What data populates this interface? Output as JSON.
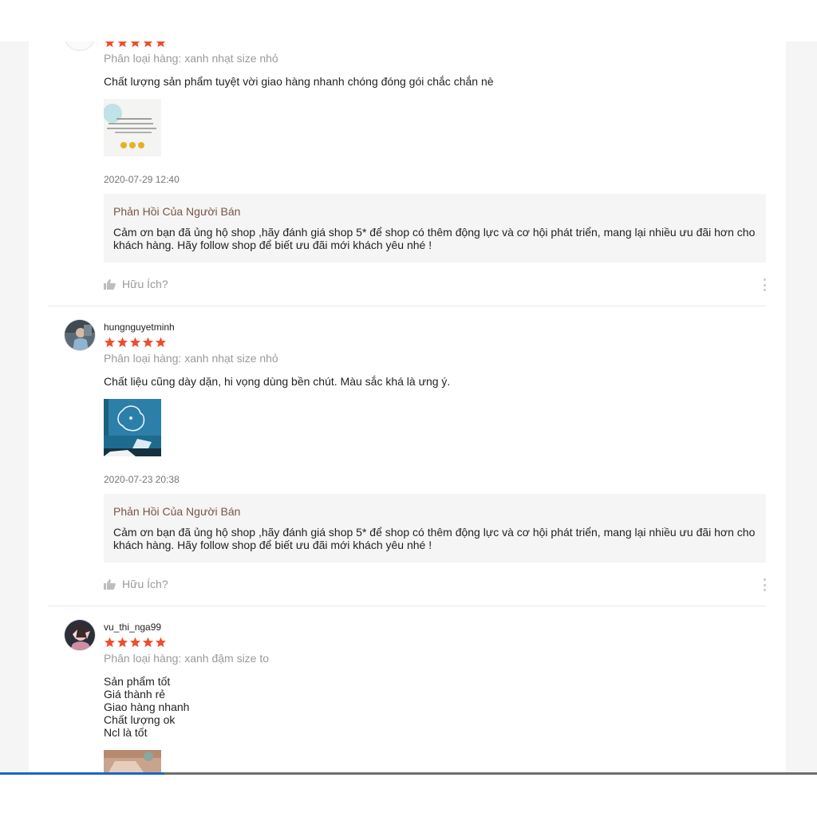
{
  "reviews": [
    {
      "username": "",
      "rating": 5,
      "variant": "Phân loại hàng: xanh nhạt size nhỏ",
      "comment": "Chất lượng sản phẩm tuyệt vời giao hàng nhanh chóng đóng gói chắc chắn nè",
      "time": "2020-07-29 12:40",
      "reply_title": "Phản Hồi Của Người Bán",
      "reply_text": "Cảm ơn bạn đã ủng hộ shop ,hãy đánh giá shop 5* để shop có thêm động lực và cơ hội phát triển, mang lại nhiều ưu đãi hơn cho khách hàng. Hãy follow shop để biết ưu đãi mới khách yêu nhé !",
      "helpful": "Hữu Ích?"
    },
    {
      "username": "hungnguyetminh",
      "rating": 5,
      "variant": "Phân loại hàng: xanh nhạt size nhỏ",
      "comment": "Chất liệu cũng dày dặn, hi vọng dùng bền chút. Màu sắc khá là ưng ý.",
      "time": "2020-07-23 20:38",
      "reply_title": "Phản Hồi Của Người Bán",
      "reply_text": "Cảm ơn bạn đã ủng hộ shop ,hãy đánh giá shop 5* để shop có thêm động lực và cơ hội phát triển, mang lại nhiều ưu đãi hơn cho khách hàng. Hãy follow shop để biết ưu đãi mới khách yêu nhé !",
      "helpful": "Hữu Ích?"
    },
    {
      "username": "vu_thi_nga99",
      "rating": 5,
      "variant": "Phân loại hàng: xanh đậm size to",
      "comment": "Sản phẩm tốt\nGiá thành rẻ\nGiao hàng nhanh\nChất lượng ok\nNcl là tốt"
    }
  ],
  "colors": {
    "star": "#ee4d2d",
    "reply_bg": "#f5f5f5",
    "reply_title": "#795548",
    "meta": "#9a9a9a"
  },
  "icons": {
    "star": "star-icon",
    "helpful": "thumbs-up-icon",
    "more": "more-vertical-icon"
  }
}
